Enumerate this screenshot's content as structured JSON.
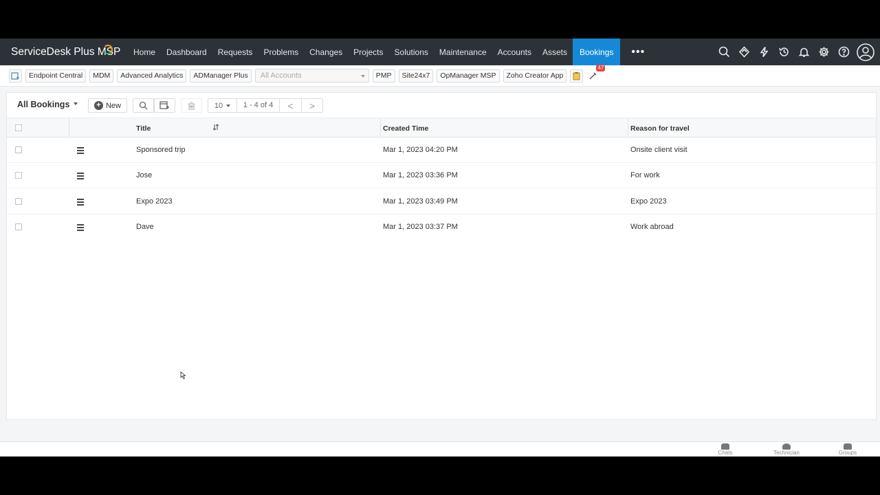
{
  "brand": {
    "name": "ServiceDesk Plus MSP"
  },
  "nav": {
    "items": [
      "Home",
      "Dashboard",
      "Requests",
      "Problems",
      "Changes",
      "Projects",
      "Solutions",
      "Maintenance",
      "Accounts",
      "Assets",
      "Bookings"
    ],
    "active": "Bookings",
    "more_label": "•••",
    "icons": [
      "search-icon",
      "diamond-icon",
      "lightning-icon",
      "history-icon",
      "bell-icon",
      "gear-icon",
      "help-icon",
      "avatar-icon"
    ]
  },
  "apps": {
    "buttons": [
      "Endpoint Central",
      "MDM",
      "Advanced Analytics",
      "ADManager Plus"
    ],
    "account_placeholder": "All Accounts",
    "buttons_after": [
      "PMP",
      "Site24x7",
      "OpManager MSP",
      "Zoho Creator App"
    ],
    "notification_count": "47"
  },
  "toolbar": {
    "view_label": "All Bookings",
    "new_label": "New",
    "per_page": "10",
    "range": "1 - 4 of 4",
    "prev": "<",
    "next": ">"
  },
  "table": {
    "columns": [
      "Title",
      "Created Time",
      "Reason for travel"
    ],
    "rows": [
      {
        "title": "Sponsored trip",
        "created": "Mar 1, 2023 04:20 PM",
        "reason": "Onsite client visit"
      },
      {
        "title": "Jose",
        "created": "Mar 1, 2023 03:36 PM",
        "reason": "For work"
      },
      {
        "title": "Expo 2023",
        "created": "Mar 1, 2023 03:49 PM",
        "reason": "Expo 2023"
      },
      {
        "title": "Dave",
        "created": "Mar 1, 2023 03:37 PM",
        "reason": "Work abroad"
      }
    ]
  },
  "bottom": {
    "items": [
      "Chats",
      "Technician",
      "Groups"
    ]
  },
  "colors": {
    "nav_bg": "#2c3238",
    "accent": "#1589d8",
    "badge": "#e84141"
  }
}
